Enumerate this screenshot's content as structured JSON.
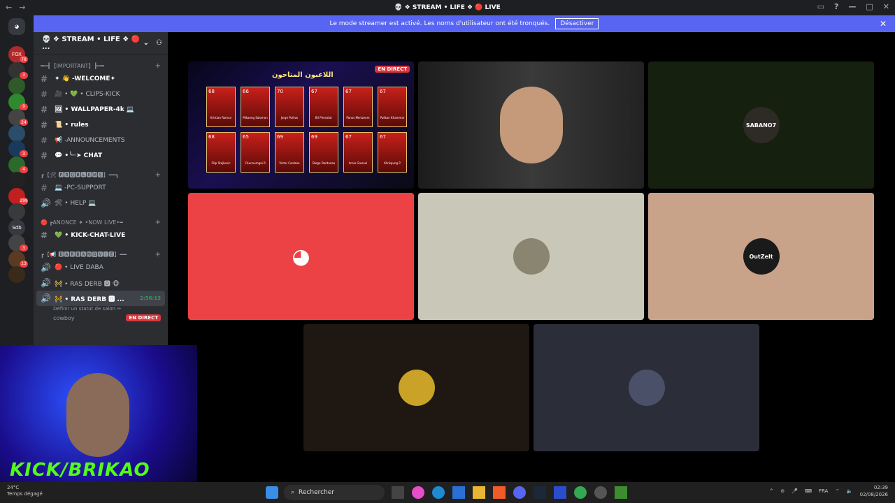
{
  "window": {
    "title": "💀 ❖ STREAM • LIFE ❖ 🔴 LIVE"
  },
  "banner": {
    "text": "Le mode streamer est activé. Les noms d'utilisateur ont été tronqués.",
    "button": "Désactiver"
  },
  "rail": {
    "servers": [
      {
        "label": "FOX",
        "badge": "78"
      },
      {
        "label": "",
        "badge": "3"
      },
      {
        "label": "",
        "badge": ""
      },
      {
        "label": "",
        "badge": "9"
      },
      {
        "label": "",
        "badge": "24"
      },
      {
        "label": "",
        "badge": ""
      },
      {
        "label": "",
        "badge": "3"
      },
      {
        "label": "",
        "badge": "4"
      },
      {
        "label": "",
        "badge": ""
      },
      {
        "label": "",
        "badge": "299"
      },
      {
        "label": "",
        "badge": ""
      },
      {
        "label": "Sdb",
        "badge": ""
      },
      {
        "label": "",
        "badge": "3"
      },
      {
        "label": "",
        "badge": "13"
      },
      {
        "label": "",
        "badge": ""
      }
    ]
  },
  "sidebar": {
    "server_name": "💀 ❖ STREAM • LIFE ❖ 🔴 ...",
    "categories": [
      {
        "name": "═━┫【IMPORTANT】┣━═",
        "channels": [
          {
            "icon": "#",
            "name": "✦ 👋 -WELCOME✦",
            "bold": true
          },
          {
            "icon": "#",
            "name": "🎥 • 💚 • CLIPS-KICK",
            "bold": false
          },
          {
            "icon": "#",
            "name": "🖼 • WALLPAPER-4k 💻",
            "bold": true
          },
          {
            "icon": "#",
            "name": "📜 • rules",
            "bold": true
          },
          {
            "icon": "#",
            "name": "📢 -ANNOUNCEMENTS",
            "bold": false
          },
          {
            "icon": "#",
            "name": "💬 •╰┈➤ CHAT",
            "bold": true
          }
        ]
      },
      {
        "name": "┏【🛠 🅿🆁🅾🅱🅻🅴🅼🆂】━━┓",
        "channels": [
          {
            "icon": "#",
            "name": "💻 -PC-SUPPORT",
            "bold": false
          },
          {
            "icon": "🔊",
            "name": "🛠 • HELP 💻",
            "bold": false
          }
        ]
      },
      {
        "name": "🔴 ┏ANONCE ✦ •NOW LIVE•━",
        "channels": [
          {
            "icon": "#",
            "name": "💚 • KICK-CHAT-LIVE",
            "bold": true
          }
        ]
      },
      {
        "name": "┏【📢 🅳🅰🆁🅱🅰🅼🅾🆅🅸🅴】━━",
        "channels": [
          {
            "icon": "🔊",
            "name": "🔴 • LIVE DABA",
            "bold": false
          },
          {
            "icon": "🔊",
            "name": "🚧 • RAS DERB 🅾 🐵",
            "bold": false
          },
          {
            "icon": "🔊",
            "name": "🚧 • RAS DERB 🅾 ...",
            "bold": true,
            "time": "2:56:13",
            "sub": "Définir un statut de salon ✏"
          }
        ]
      }
    ],
    "voice_user": {
      "name": "cowboy",
      "badge": "EN DIRECT"
    }
  },
  "stage": {
    "screenshare": {
      "title": "اللاعبون المتاحون",
      "live": "EN DIRECT",
      "cards": [
        {
          "rating": "68",
          "name": "Kristian Roman"
        },
        {
          "rating": "66",
          "name": "Mikaeng Salomon"
        },
        {
          "rating": "70",
          "name": "Jorge Pulhas"
        },
        {
          "rating": "67",
          "name": "Bil Phenafar"
        },
        {
          "rating": "67",
          "name": "Panos Mertzenm"
        },
        {
          "rating": "67",
          "name": "Pulikan Khammar"
        },
        {
          "rating": "68",
          "name": "Filip Stojkovic"
        },
        {
          "rating": "65",
          "name": "Chunnumgai R"
        },
        {
          "rating": "69",
          "name": "Victor Cordoso"
        },
        {
          "rating": "69",
          "name": "Diogo Dardanaa"
        },
        {
          "rating": "67",
          "name": "Arnie Grossul"
        },
        {
          "rating": "67",
          "name": "Klinkpung P"
        }
      ]
    },
    "tiles": [
      {
        "name": "user-tile-webcam",
        "color": "#2a2a2a",
        "label": ""
      },
      {
        "name": "user-tile-sabano",
        "color": "#16200f",
        "label": "SABANO7"
      },
      {
        "name": "user-tile-discord-default",
        "color": "#ed4245",
        "label": ""
      },
      {
        "name": "user-tile-cowboy",
        "color": "#c9c7b7",
        "label": ""
      },
      {
        "name": "user-tile-outzelt",
        "color": "#c9a28a",
        "label": "OutZelt"
      },
      {
        "name": "user-tile-gold",
        "color": "#1e1712",
        "label": ""
      },
      {
        "name": "user-tile-dark",
        "color": "#2b2d38",
        "label": ""
      }
    ]
  },
  "webcam": {
    "overlay": "KICK/BRIKAO"
  },
  "taskbar": {
    "weather_temp": "24°C",
    "weather_text": "Temps dégagé",
    "search": "Rechercher",
    "lang": "FRA",
    "time": "02:39",
    "date": "02/08/2026"
  }
}
